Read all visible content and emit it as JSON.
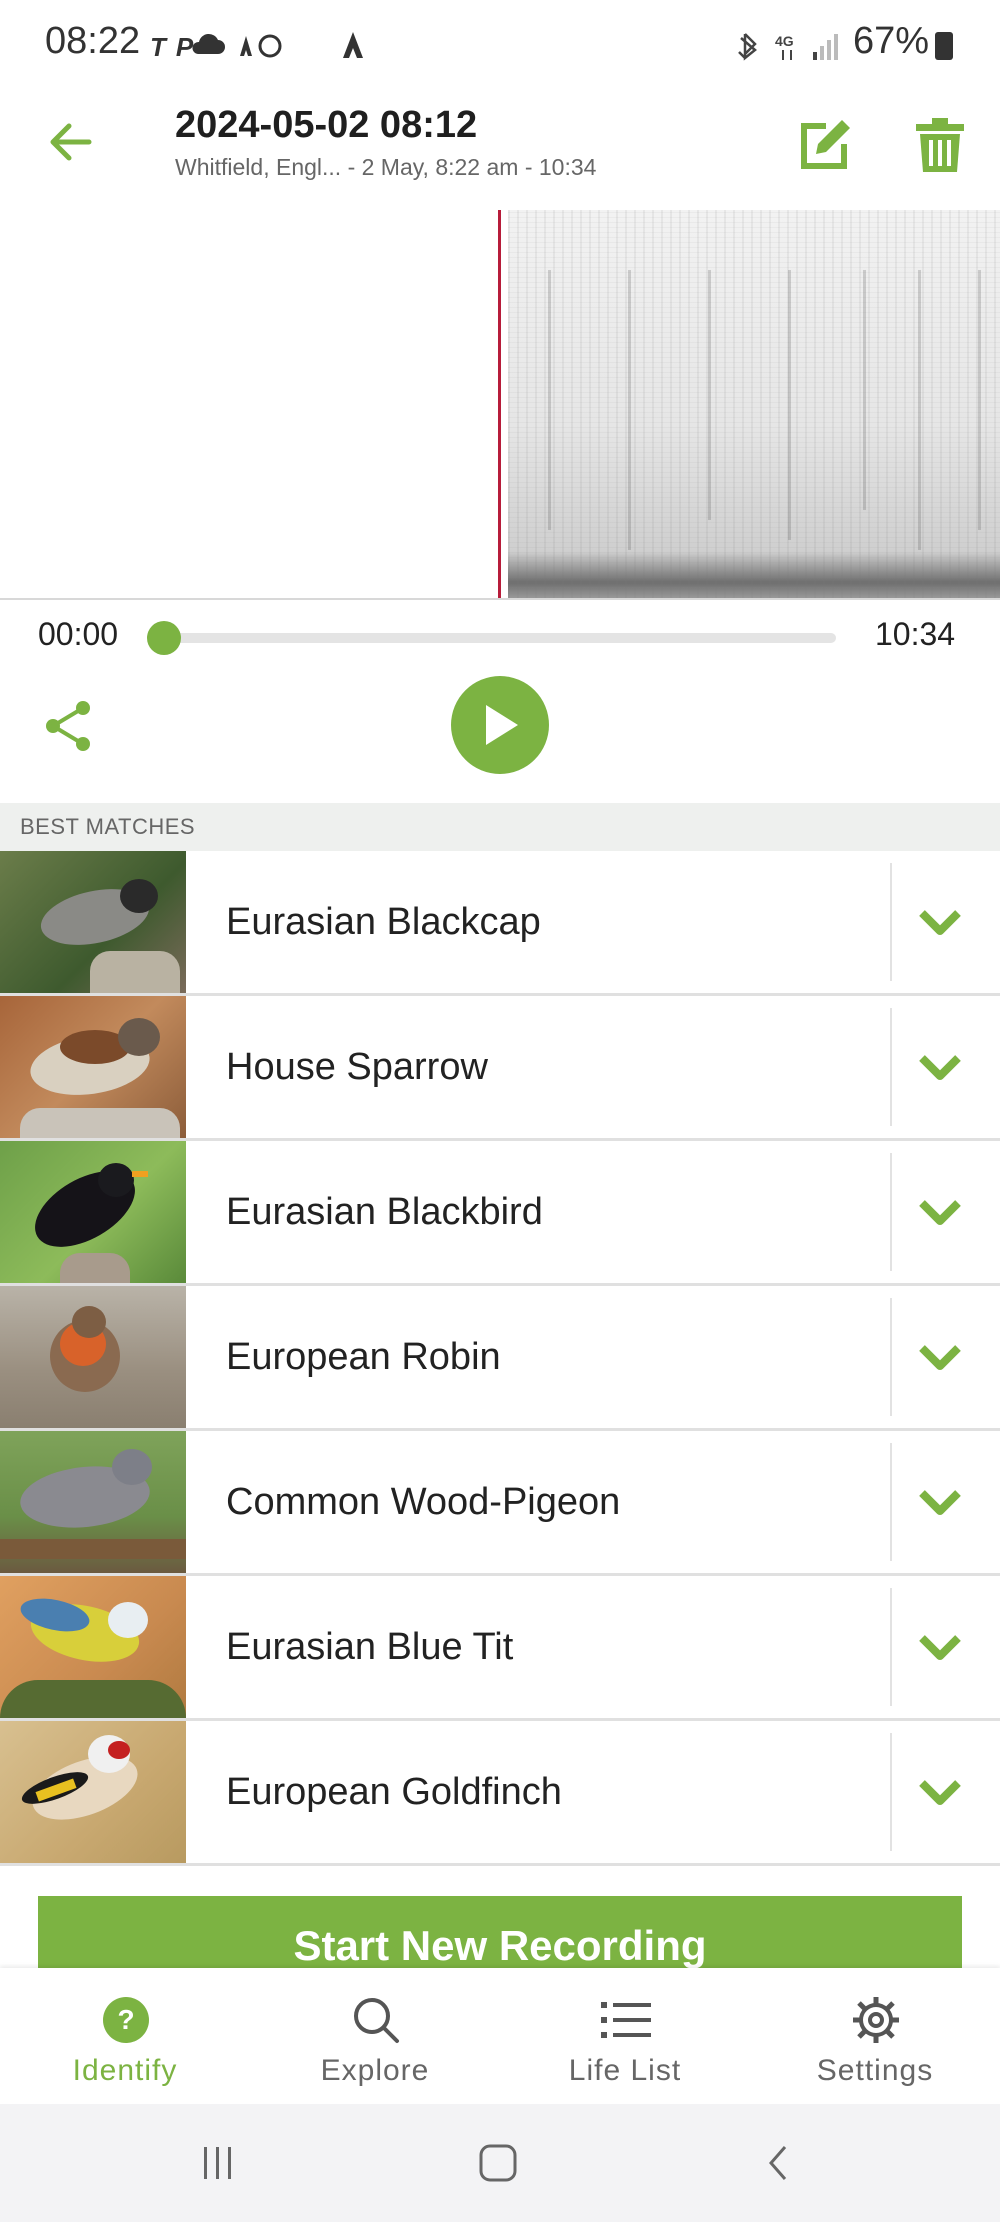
{
  "status_bar": {
    "time": "08:22",
    "left_icons": [
      "tp-icon",
      "cloud-icon",
      "strava-icon",
      "sync-icon",
      "strava-icon"
    ],
    "right_icons": [
      "bluetooth-icon",
      "4g-icon",
      "signal-icon"
    ],
    "net": "4G",
    "battery": "67%"
  },
  "header": {
    "title": "2024-05-02 08:12",
    "subtitle": "Whitfield, Engl... - 2 May, 8:22 am - 10:34"
  },
  "player": {
    "current_time": "00:00",
    "total_time": "10:34",
    "progress": 0
  },
  "matches": {
    "section_label": "BEST MATCHES",
    "items": [
      {
        "name": "Eurasian Blackcap"
      },
      {
        "name": "House Sparrow"
      },
      {
        "name": "Eurasian Blackbird"
      },
      {
        "name": "European Robin"
      },
      {
        "name": "Common Wood-Pigeon"
      },
      {
        "name": "Eurasian Blue Tit"
      },
      {
        "name": "European Goldfinch"
      }
    ]
  },
  "start_button": "Start New Recording",
  "bottom_nav": [
    {
      "label": "Identify",
      "icon": "question-icon",
      "active": true
    },
    {
      "label": "Explore",
      "icon": "search-icon",
      "active": false
    },
    {
      "label": "Life List",
      "icon": "list-icon",
      "active": false
    },
    {
      "label": "Settings",
      "icon": "gear-icon",
      "active": false
    }
  ],
  "colors": {
    "accent": "#7cb342",
    "playhead": "#b71c3a"
  }
}
